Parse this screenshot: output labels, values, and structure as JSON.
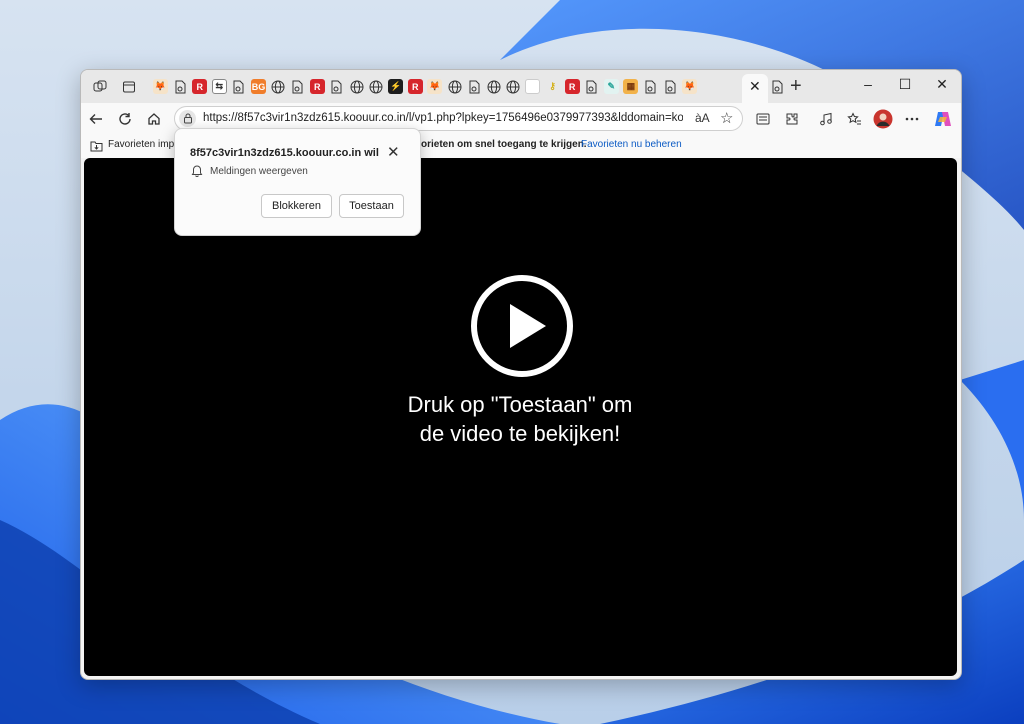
{
  "browser": {
    "address_bar": {
      "url": "https://8f57c3vir1n3zdz615.koouur.co.in/l/vp1.php?lpkey=1756496e0379977393&lddomain=ko..."
    },
    "favorites_bar": {
      "import_text": "Favorieten impo",
      "hint_text": "orieten om snel toegang te krijgen.",
      "manage_link": "Favorieten nu beheren"
    },
    "tab_favicons": [
      "fox",
      "page",
      "red",
      "arrows",
      "page",
      "orange-bg",
      "globe",
      "page",
      "red",
      "page",
      "globe",
      "globe",
      "green-bolt",
      "red",
      "fox",
      "globe",
      "page",
      "globe",
      "globe",
      "white",
      "key",
      "red",
      "page",
      "leaf",
      "tiger",
      "page",
      "page",
      "fox"
    ],
    "tab_letters": {
      "orange-bg": "BG"
    },
    "window_controls": {
      "minimize": "–",
      "maximize": "☐",
      "close": "✕"
    },
    "tab_close": "✕",
    "new_tab": "+",
    "read_aloud": "àA",
    "favorite_star": "☆"
  },
  "permission_popup": {
    "title": "8f57c3vir1n3zdz615.koouur.co.in wil",
    "permission": "Meldingen weergeven",
    "block_label": "Blokkeren",
    "allow_label": "Toestaan",
    "close_glyph": "✕"
  },
  "video": {
    "line1": "Druk op \"Toestaan\" om",
    "line2": "de video te bekijken!"
  },
  "colors": {
    "page_bg": "#000000",
    "accent_link": "#0c5bc4",
    "red_favicon": "#d6262c",
    "orange_favicon": "#f07d2b"
  }
}
